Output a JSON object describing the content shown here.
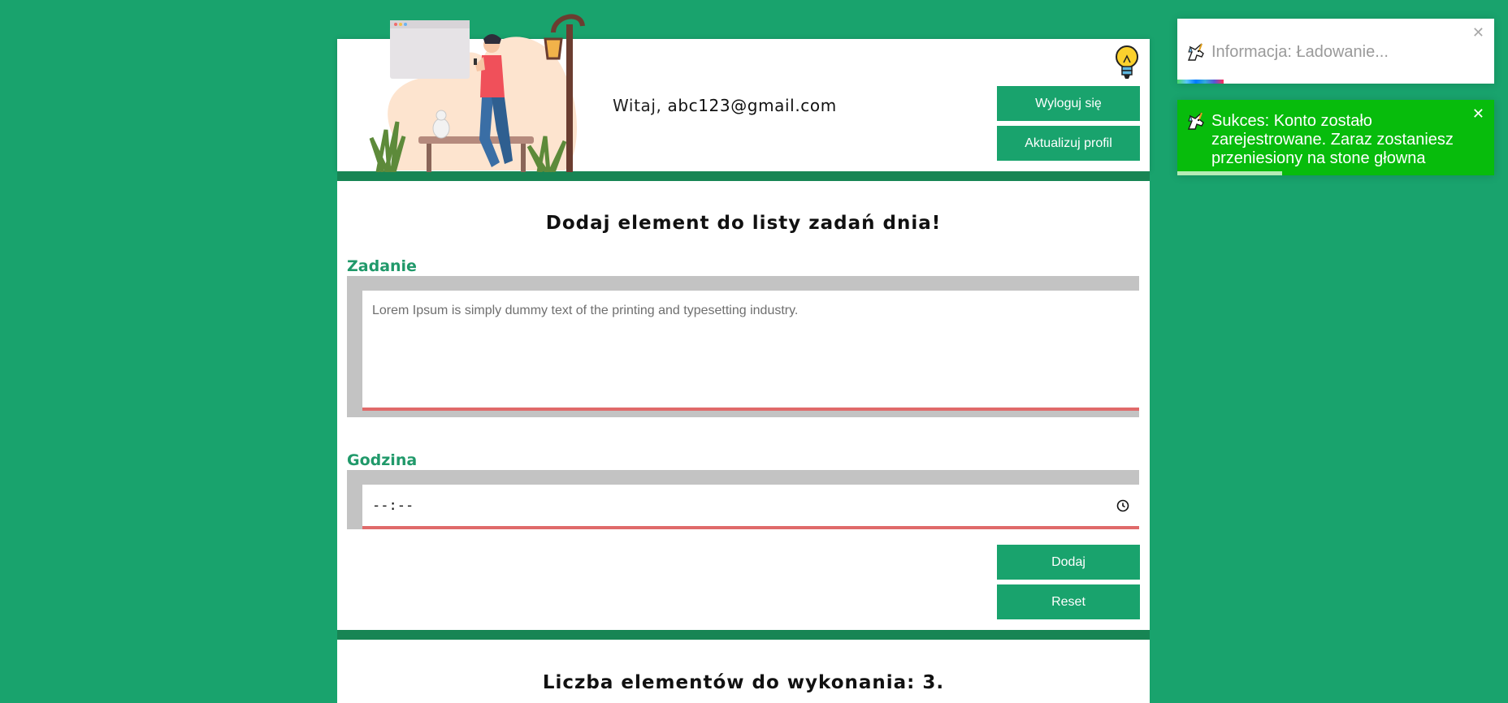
{
  "header": {
    "greeting_prefix": "Witaj, ",
    "user_email": "abc123@gmail.com",
    "logout_label": "Wyloguj się",
    "update_profile_label": "Aktualizuj profil"
  },
  "form": {
    "title": "Dodaj element do listy zadań dnia!",
    "task_label": "Zadanie",
    "task_placeholder": "Lorem Ipsum is simply dummy text of the printing and typesetting industry.",
    "time_label": "Godzina",
    "time_placeholder": "--:--",
    "add_label": "Dodaj",
    "reset_label": "Reset"
  },
  "list": {
    "title": "Liczba elementów do wykonania: 3."
  },
  "toasts": {
    "info": {
      "text": "Informacja: Ładowanie...",
      "progress": 0.145
    },
    "success": {
      "text": "Sukces: Konto zostało zarejestrowane. Zaraz zostaniesz przeniesiony na stone głowna",
      "progress": 0.33
    }
  },
  "colors": {
    "page_background": "#19a36d",
    "accent_dark": "#178554",
    "button": "#19a36d",
    "label": "#20996a",
    "input_underline": "#e06a6a",
    "success_toast": "#07bc0c"
  },
  "icons": [
    "lightbulb-icon",
    "clock-icon",
    "unicorn-icon",
    "close-icon"
  ]
}
